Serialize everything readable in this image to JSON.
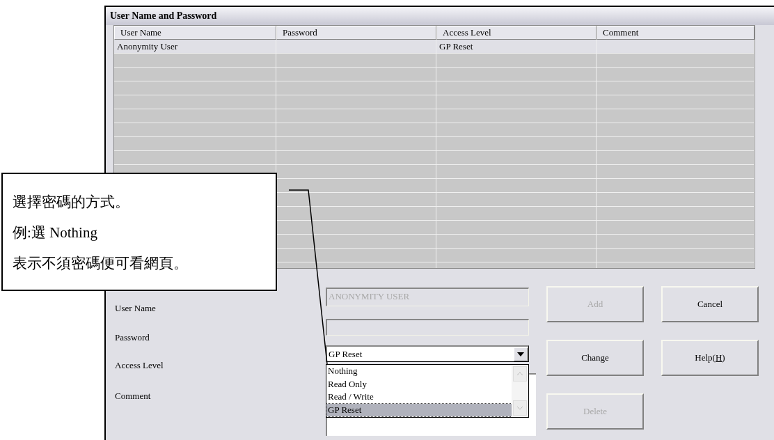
{
  "window": {
    "title": "User Name and Password"
  },
  "table": {
    "columns": [
      "User Name",
      "Password",
      "Access Level",
      "Comment"
    ],
    "rows": [
      {
        "user_name": "Anonymity User",
        "access_level": "GP Reset"
      }
    ]
  },
  "form": {
    "fields": [
      {
        "kind": "text",
        "label": "User Name",
        "value": "ANONYMITY USER",
        "disabled": true
      },
      {
        "kind": "password",
        "label": "Password",
        "disabled": true
      },
      {
        "kind": "combo",
        "label": "Access Level",
        "value": "GP Reset",
        "expanded": true,
        "options": [
          {
            "label": "Nothing",
            "selected": false
          },
          {
            "label": "Read Only",
            "selected": false
          },
          {
            "label": "Read / Write",
            "selected": false
          },
          {
            "label": "GP Reset",
            "selected": true
          }
        ]
      },
      {
        "kind": "textarea",
        "label": "Comment"
      }
    ]
  },
  "buttons": [
    {
      "label": "Add",
      "disabled": true
    },
    {
      "label": "Cancel",
      "disabled": false
    },
    {
      "label": "Change",
      "disabled": false
    },
    {
      "label": "Help(",
      "mnemonic": "H",
      "label_after": ")",
      "disabled": false
    },
    {
      "label": "Delete",
      "disabled": true
    }
  ],
  "callout": {
    "lines": [
      "選擇密碼的方式。",
      "例:選 Nothing",
      "表示不須密碼便可看網頁。"
    ]
  }
}
